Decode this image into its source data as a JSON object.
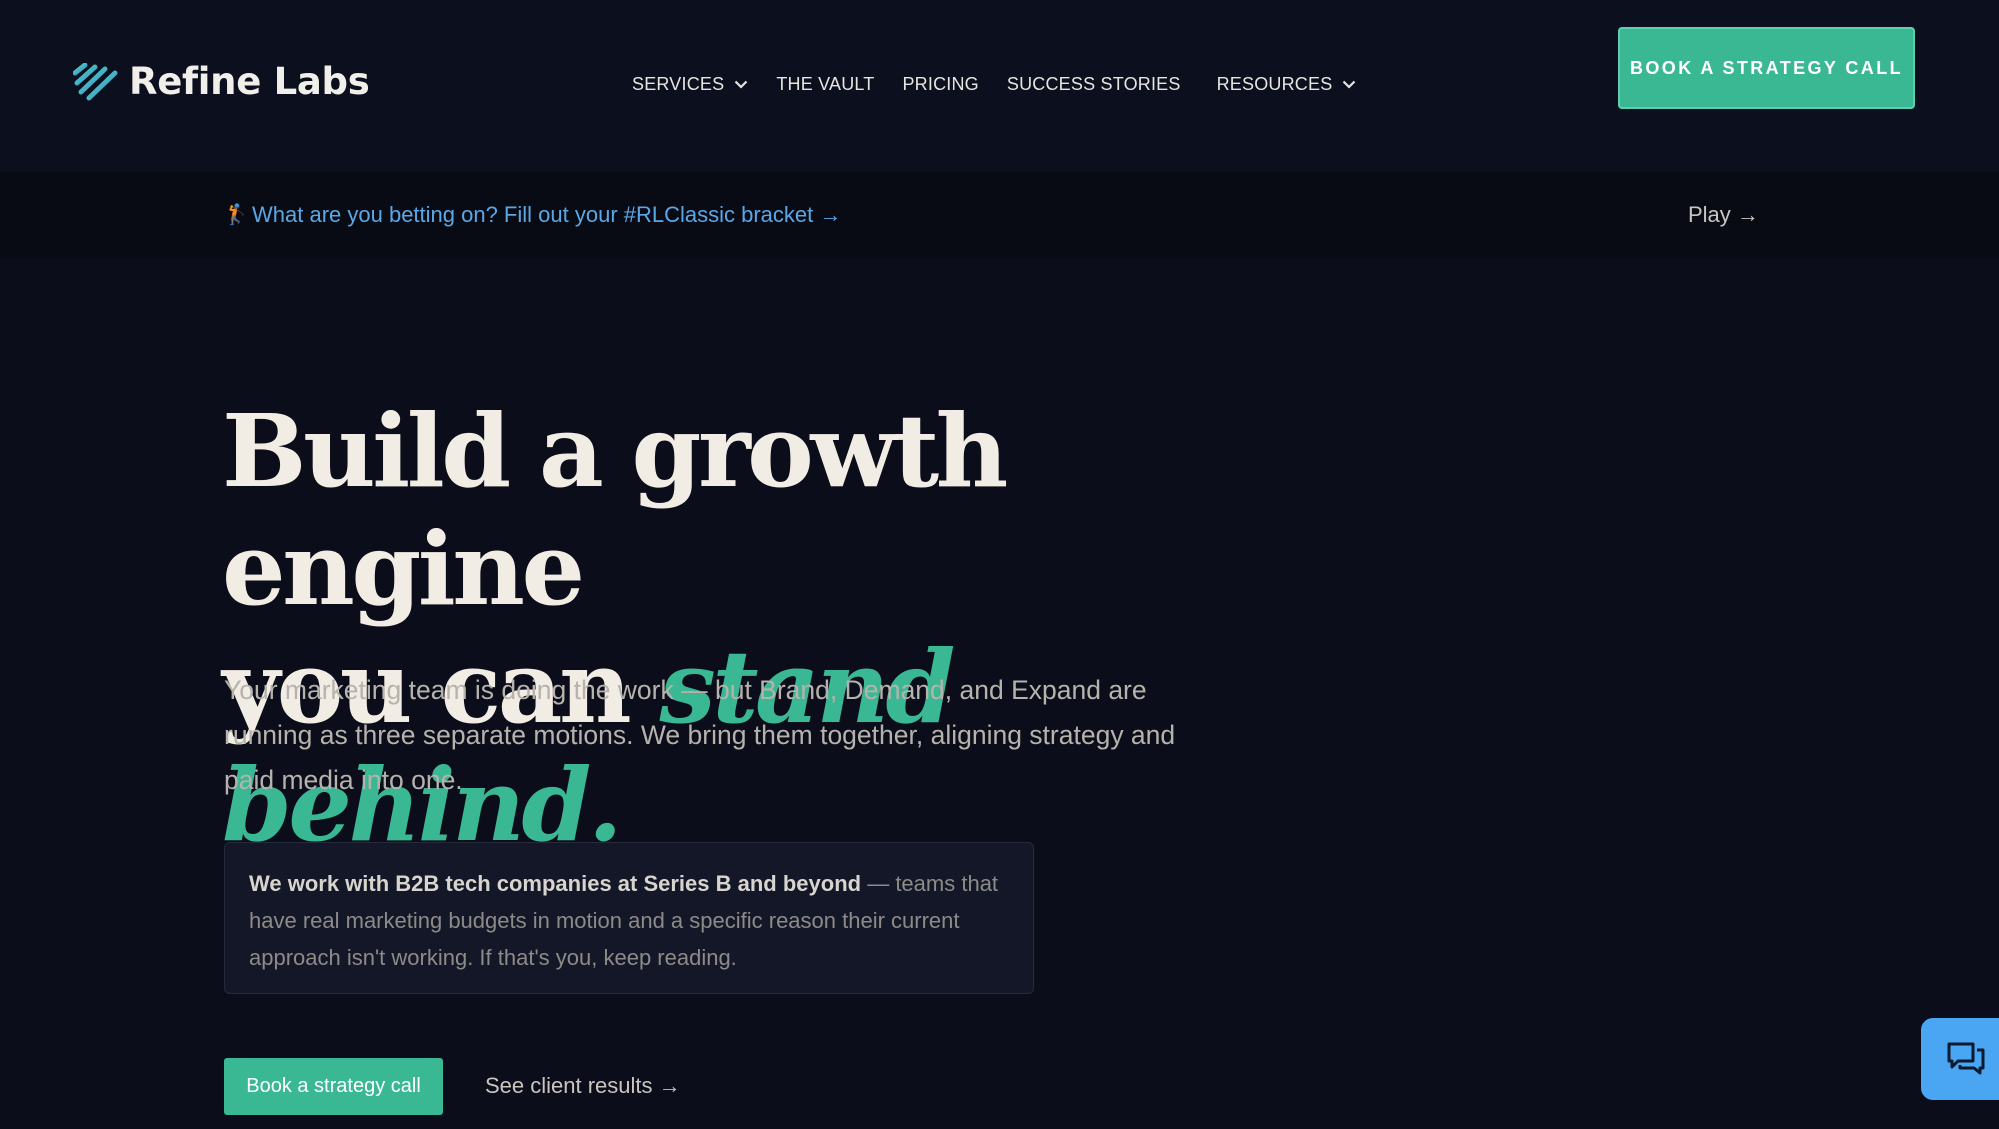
{
  "brand": {
    "name": "Refine Labs",
    "accent": "#3ab894"
  },
  "nav": {
    "items": [
      {
        "label": "SERVICES",
        "dropdown": true
      },
      {
        "label": "THE VAULT",
        "dropdown": false
      },
      {
        "label": "PRICING",
        "dropdown": false
      },
      {
        "label": "SUCCESS STORIES",
        "dropdown": false
      },
      {
        "label": "RESOURCES",
        "dropdown": true
      }
    ],
    "cta_label": "BOOK A STRATEGY CALL"
  },
  "announcement": {
    "emoji": "🏌️",
    "text": "What are you betting on? Fill out your #RLClassic bracket →",
    "play_label": "Play →"
  },
  "hero": {
    "title_line1": "Build a growth engine",
    "title_line2_plain": "you can",
    "title_line2_accent": "stand behind.",
    "subtitle": "Your marketing team is doing the work — but Brand, Demand, and Expand are running as three separate motions. We bring them together, aligning strategy and paid media into one.",
    "note_bold": "We work with B2B tech companies at Series B and beyond",
    "note_rest": " — teams that have real marketing budgets in motion and a specific reason their current approach isn't working. If that's you, keep reading.",
    "primary_cta": "Book a strategy call",
    "secondary_cta": "See client results →"
  },
  "chat": {
    "icon": "chat-icon"
  }
}
